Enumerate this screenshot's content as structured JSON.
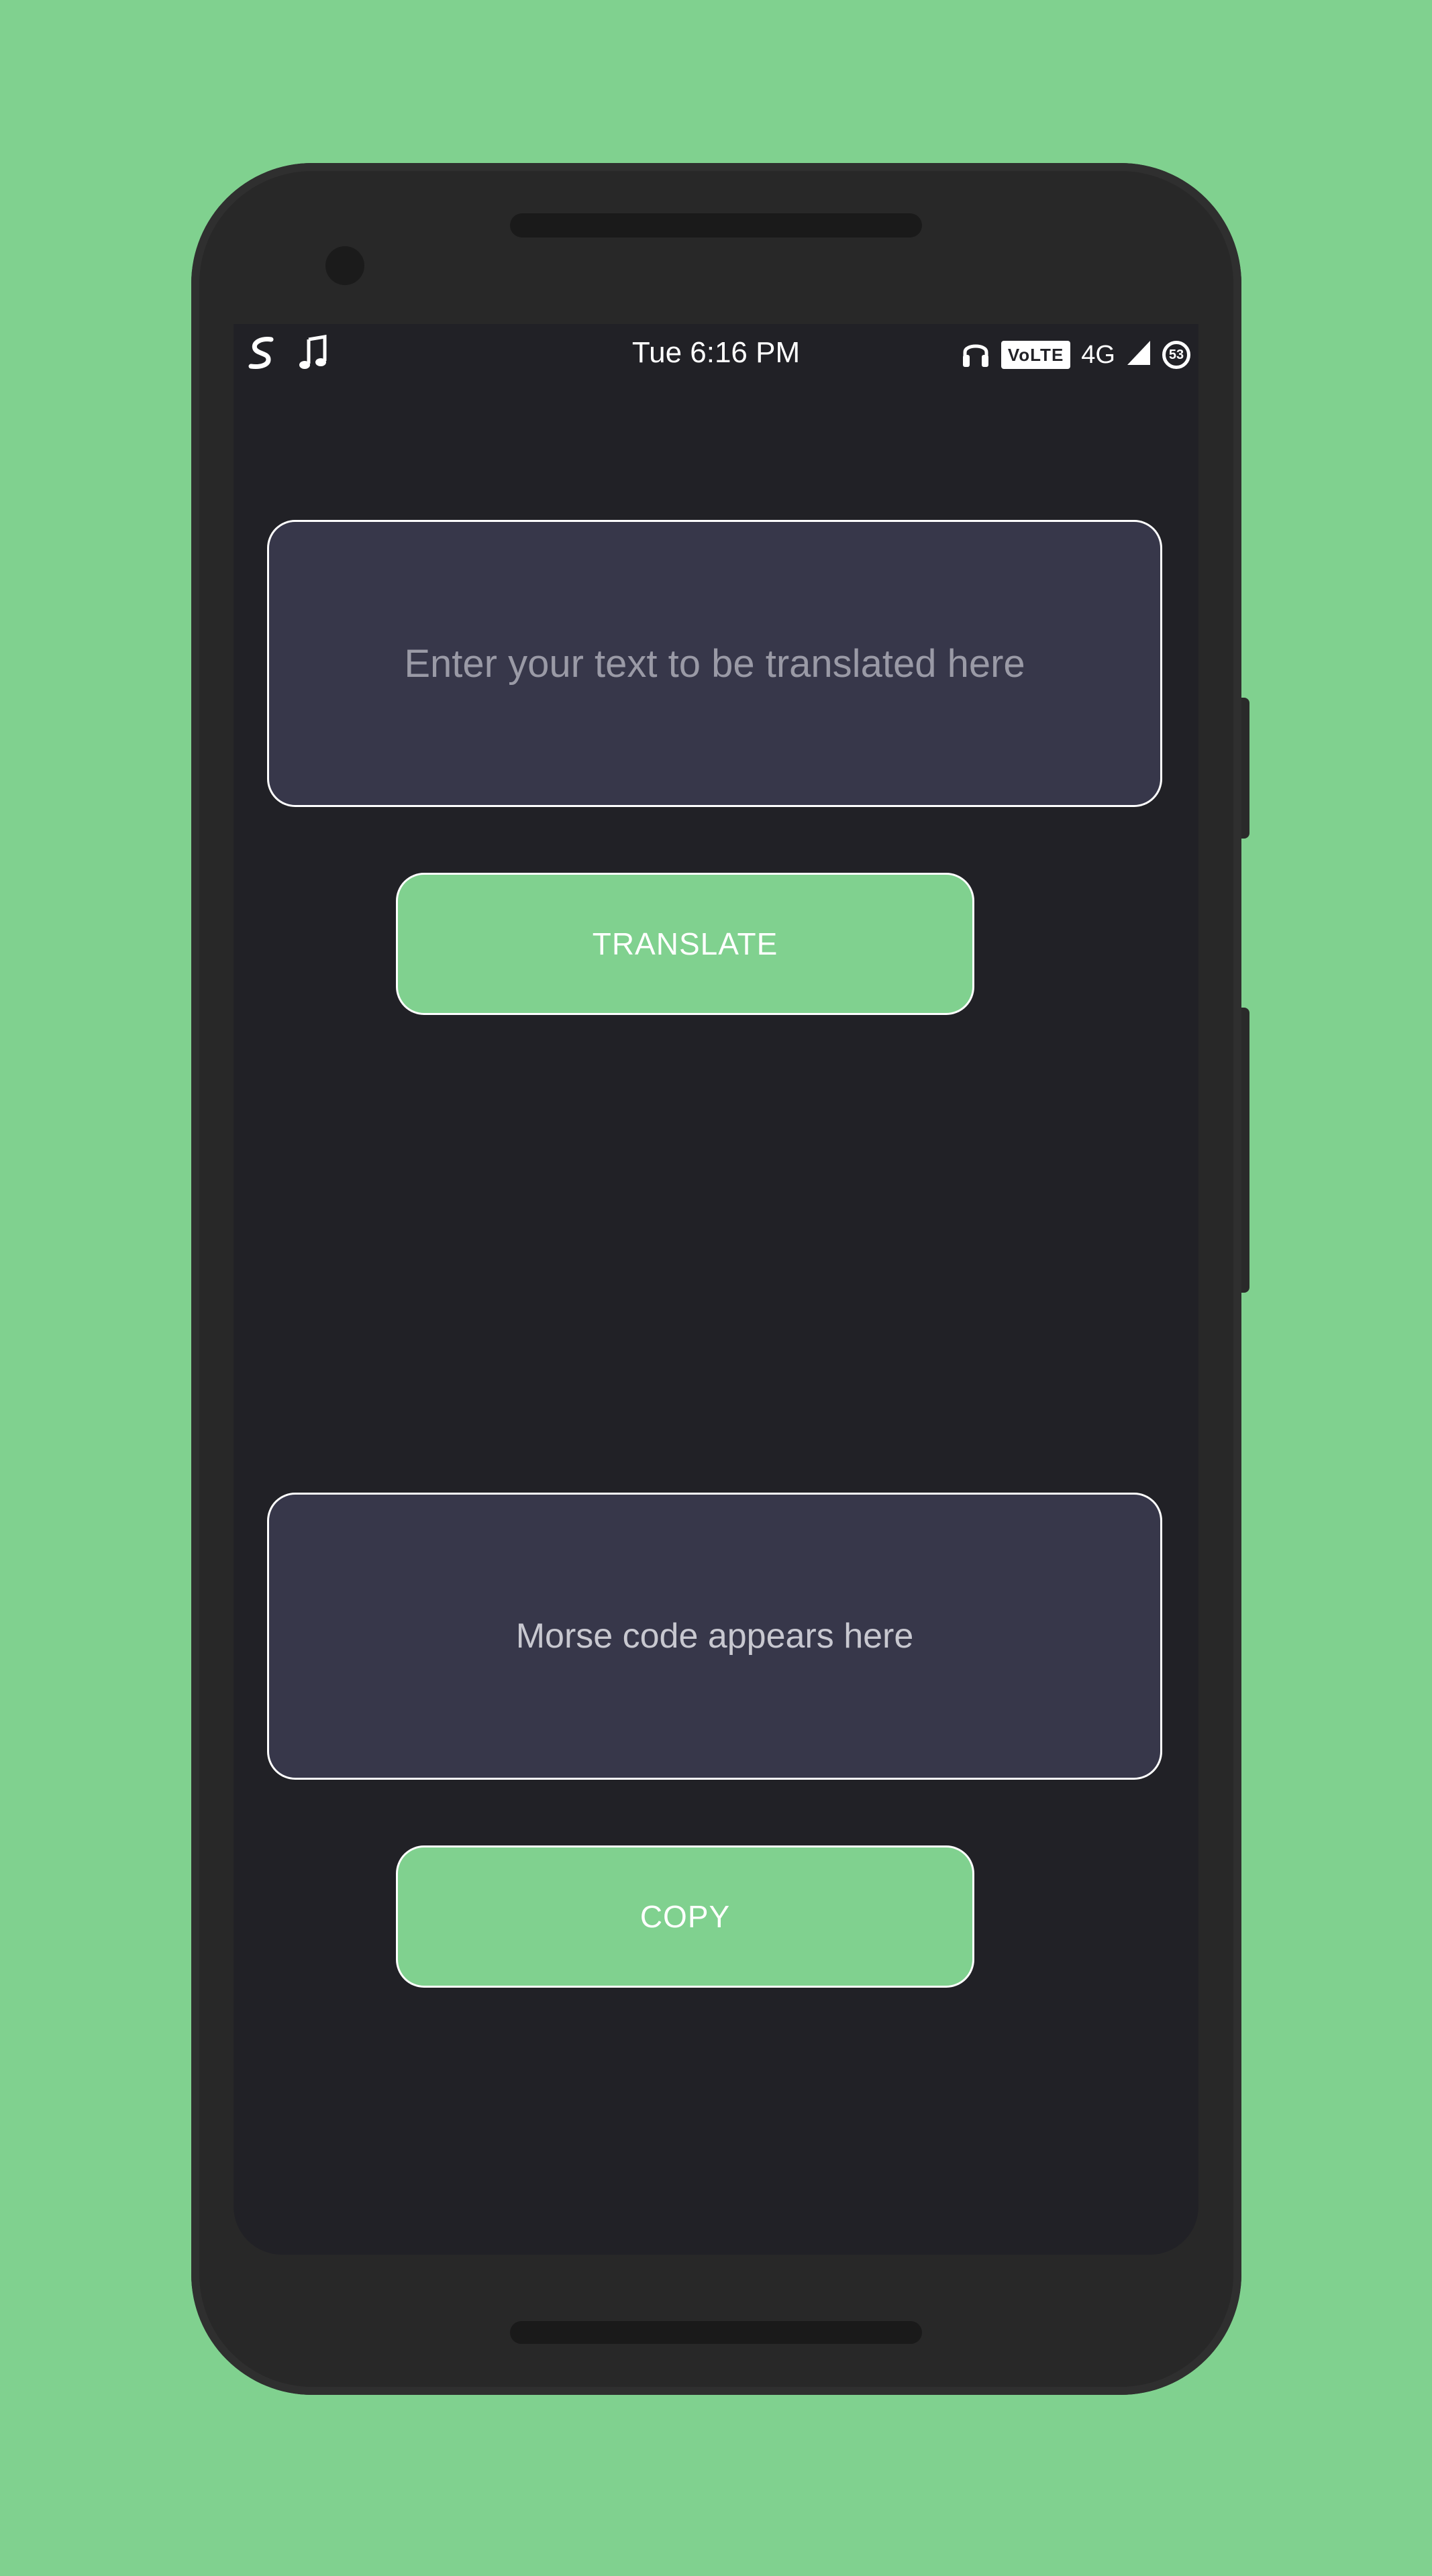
{
  "status_bar": {
    "time": "Tue 6:16 PM",
    "left_icons": [
      "app-s-icon",
      "music-note-icon"
    ],
    "volte_label": "VoLTE",
    "network_label": "4G",
    "battery_level": "53",
    "right_icons": [
      "headphones-icon",
      "signal-icon",
      "battery-icon"
    ]
  },
  "input": {
    "placeholder": "Enter your text to be translated here",
    "value": ""
  },
  "translate_button": {
    "label": "TRANSLATE"
  },
  "output": {
    "placeholder": "Morse code appears here"
  },
  "copy_button": {
    "label": "COPY"
  },
  "colors": {
    "background": "#80d18f",
    "phone_body": "#282828",
    "screen": "#212126",
    "text_box": "#37374a",
    "button": "#80d18f",
    "border": "#ffffff"
  }
}
